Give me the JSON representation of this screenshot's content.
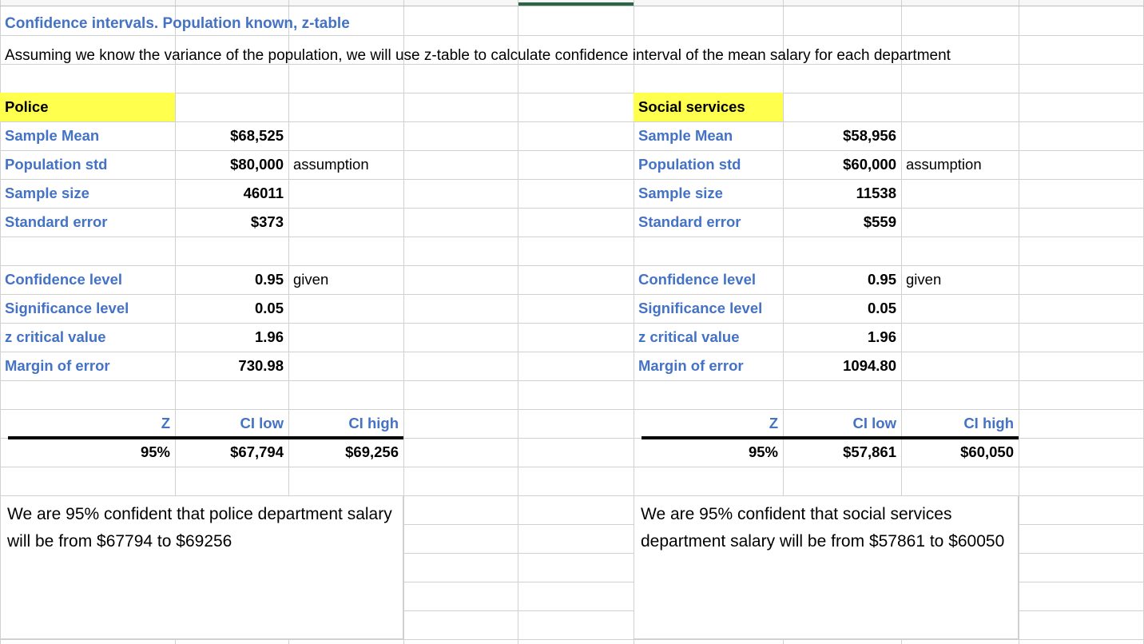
{
  "document": {
    "title": "Confidence intervals. Population known, z-table",
    "subtitle": "Assuming we know the variance of the population, we will use z-table to calculate confidence interval of the mean salary for each department"
  },
  "colors": {
    "label_blue": "#4472C4",
    "highlight_yellow": "#FFFF4D",
    "selection_green": "#2B6447",
    "gridline": "#D0D0D0",
    "value_black": "#000000"
  },
  "blocks": [
    {
      "id": "police",
      "header": "Police",
      "rows": [
        {
          "label": "Sample Mean",
          "value": "$68,525",
          "note": ""
        },
        {
          "label": "Population std",
          "value": "$80,000",
          "note": "assumption"
        },
        {
          "label": "Sample size",
          "value": "46011",
          "note": ""
        },
        {
          "label": "Standard error",
          "value": "$373",
          "note": ""
        }
      ],
      "stats": [
        {
          "label": "Confidence level",
          "value": "0.95",
          "note": "given"
        },
        {
          "label": "Significance level",
          "value": "0.05",
          "note": ""
        },
        {
          "label": "z critical value",
          "value": "1.96",
          "note": ""
        },
        {
          "label": "Margin of error",
          "value": "730.98",
          "note": ""
        }
      ],
      "ci_headers": [
        "Z",
        "CI low",
        "CI high"
      ],
      "ci_values": [
        "95%",
        "$67,794",
        "$69,256"
      ],
      "conclusion": "We are 95% confident that police department salary will be from $67794 to $69256"
    },
    {
      "id": "social-services",
      "header": "Social services",
      "rows": [
        {
          "label": "Sample Mean",
          "value": "$58,956",
          "note": ""
        },
        {
          "label": "Population std",
          "value": "$60,000",
          "note": "assumption"
        },
        {
          "label": "Sample size",
          "value": "11538",
          "note": ""
        },
        {
          "label": "Standard error",
          "value": "$559",
          "note": ""
        }
      ],
      "stats": [
        {
          "label": "Confidence level",
          "value": "0.95",
          "note": "given"
        },
        {
          "label": "Significance level",
          "value": "0.05",
          "note": ""
        },
        {
          "label": "z critical value",
          "value": "1.96",
          "note": ""
        },
        {
          "label": "Margin of error",
          "value": "1094.80",
          "note": ""
        }
      ],
      "ci_headers": [
        "Z",
        "CI low",
        "CI high"
      ],
      "ci_values": [
        "95%",
        "$57,861",
        "$60,050"
      ],
      "conclusion": "We are 95% confident that social services department salary will be from $57861 to $60050"
    }
  ]
}
